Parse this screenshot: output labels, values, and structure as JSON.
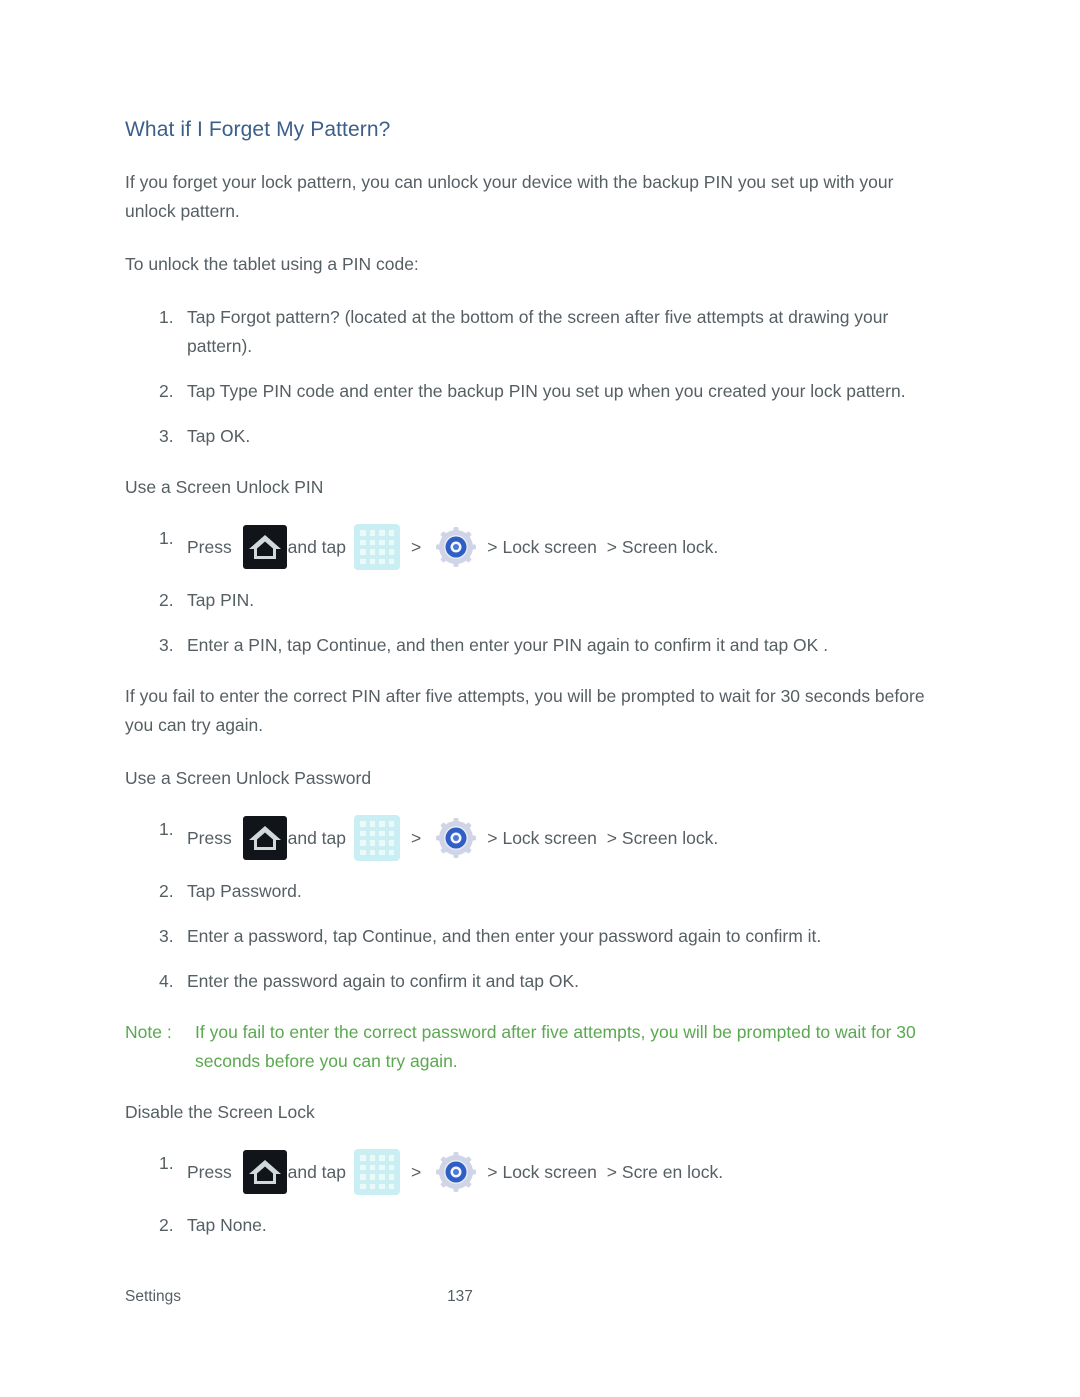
{
  "page": {
    "heading": "What if I Forget My Pattern?",
    "intro_paragraph": "If you forget your lock pattern, you can unlock your device with the backup PIN you set up with your unlock pattern.",
    "lead_in": "To unlock the tablet using a PIN code:"
  },
  "pin_unlock_steps": [
    {
      "num": "1.",
      "text": "Tap Forgot pattern?   (located at the bottom of the screen after five attempts at drawing your pattern)."
    },
    {
      "num": "2.",
      "text": "Tap Type PIN code  and enter the backup PIN you set up when you created your lock pattern."
    },
    {
      "num": "3.",
      "text": "Tap OK."
    }
  ],
  "screen_unlock_pin": {
    "subhead": "Use a Screen Unlock PIN",
    "step1": {
      "num": "1.",
      "press_label": "Press ",
      "and_tap_label": "and tap",
      "chevron": ">",
      "lock_screen_label": "Lock screen ",
      "screen_lock_label": "Screen lock."
    },
    "steps": [
      {
        "num": "2.",
        "text": "Tap PIN."
      },
      {
        "num": "3.",
        "text": "Enter a PIN, tap Continue, and then enter your PIN again to confirm it and tap OK ."
      }
    ],
    "after_paragraph": "If you fail to enter the correct PIN after five attempts, you will be prompted to wait for 30 seconds before you can try again."
  },
  "screen_unlock_password": {
    "subhead": "Use a Screen Unlock Password",
    "step1": {
      "num": "1.",
      "press_label": "Press ",
      "and_tap_label": "and tap",
      "chevron": ">",
      "lock_screen_label": "Lock screen ",
      "screen_lock_label": "Screen lock."
    },
    "steps": [
      {
        "num": "2.",
        "text": "Tap Password."
      },
      {
        "num": "3.",
        "text": "Enter a password, tap Continue, and then enter your password again to confirm it."
      },
      {
        "num": "4.",
        "text": "Enter the password again to confirm it and tap OK."
      }
    ],
    "note": {
      "label": "Note :",
      "text": "If you fail to enter the correct password after five attempts, you will be prompted to wait for 30 seconds before you can try again."
    }
  },
  "disable_screen_lock": {
    "subhead": "Disable the Screen Lock",
    "step1": {
      "num": "1.",
      "press_label": "Press ",
      "and_tap_label": "and tap",
      "chevron": ">",
      "lock_screen_label": "Lock screen ",
      "screen_lock_label": "Scre en lock."
    },
    "steps": [
      {
        "num": "2.",
        "text": "Tap None."
      }
    ]
  },
  "footer": {
    "section": "Settings",
    "page_number": "137"
  },
  "icons": {
    "home": "home-icon",
    "apps": "apps-grid-icon",
    "settings": "settings-gear-icon"
  },
  "colors": {
    "heading": "#3b5f8a",
    "body": "#555f63",
    "note": "#5aa84f",
    "apps_icon_bg": "#c9eef3",
    "home_icon_bg": "#111418",
    "gear_accent": "#2f5fc4"
  }
}
